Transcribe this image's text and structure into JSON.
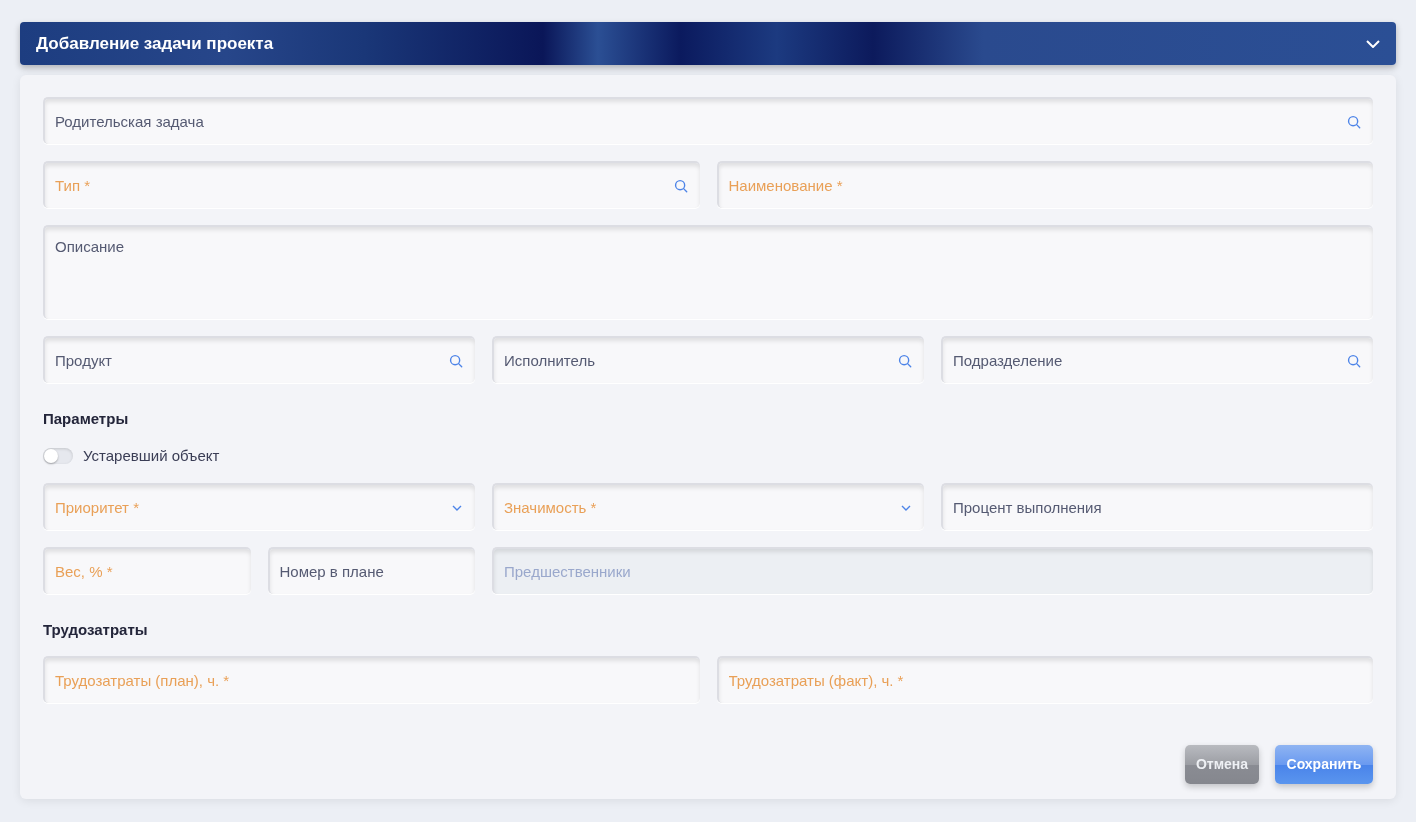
{
  "header": {
    "title": "Добавление задачи проекта",
    "expanded": true
  },
  "sections": [
    {
      "rows": [
        {
          "kind": "full",
          "fields": [
            {
              "kind": "search",
              "placeholder": "Родительская задача",
              "required": false,
              "disabled": false
            }
          ]
        },
        {
          "kind": "halves",
          "fields": [
            {
              "kind": "search",
              "placeholder": "Тип *",
              "required": true,
              "disabled": false
            },
            {
              "kind": "text",
              "placeholder": "Наименование *",
              "required": true,
              "disabled": false
            }
          ]
        },
        {
          "kind": "full",
          "fields": [
            {
              "kind": "textarea",
              "placeholder": "Описание",
              "required": false,
              "disabled": false
            }
          ]
        },
        {
          "kind": "thirds",
          "fields": [
            {
              "kind": "search",
              "placeholder": "Продукт",
              "required": false,
              "disabled": false
            },
            {
              "kind": "search",
              "placeholder": "Исполнитель",
              "required": false,
              "disabled": false
            },
            {
              "kind": "search",
              "placeholder": "Подразделение",
              "required": false,
              "disabled": false
            }
          ]
        }
      ]
    },
    {
      "title": "Параметры",
      "toggle": {
        "label": "Устаревший объект",
        "on": false
      },
      "rows": [
        {
          "kind": "thirds",
          "fields": [
            {
              "kind": "select",
              "placeholder": "Приоритет *",
              "required": true,
              "disabled": false
            },
            {
              "kind": "select",
              "placeholder": "Значимость *",
              "required": true,
              "disabled": false
            },
            {
              "kind": "text",
              "placeholder": "Процент выполнения",
              "required": false,
              "disabled": false
            }
          ]
        },
        {
          "kind": "split",
          "fields": [
            {
              "kind": "text",
              "placeholder": "Вес, % *",
              "required": true,
              "disabled": false
            },
            {
              "kind": "text",
              "placeholder": "Номер в плане",
              "required": false,
              "disabled": false
            },
            {
              "kind": "text",
              "placeholder": "Предшественники",
              "disabled": true
            }
          ]
        }
      ]
    },
    {
      "title": "Трудозатраты",
      "rows": [
        {
          "kind": "halves",
          "fields": [
            {
              "kind": "text",
              "placeholder": "Трудозатраты (план), ч. *",
              "required": true,
              "disabled": false
            },
            {
              "kind": "text",
              "placeholder": "Трудозатраты (факт), ч. *",
              "required": true,
              "disabled": false
            }
          ]
        }
      ]
    }
  ],
  "buttons": [
    {
      "kind": "cancel",
      "label": "Отмена"
    },
    {
      "kind": "primary",
      "label": "Сохранить"
    }
  ]
}
